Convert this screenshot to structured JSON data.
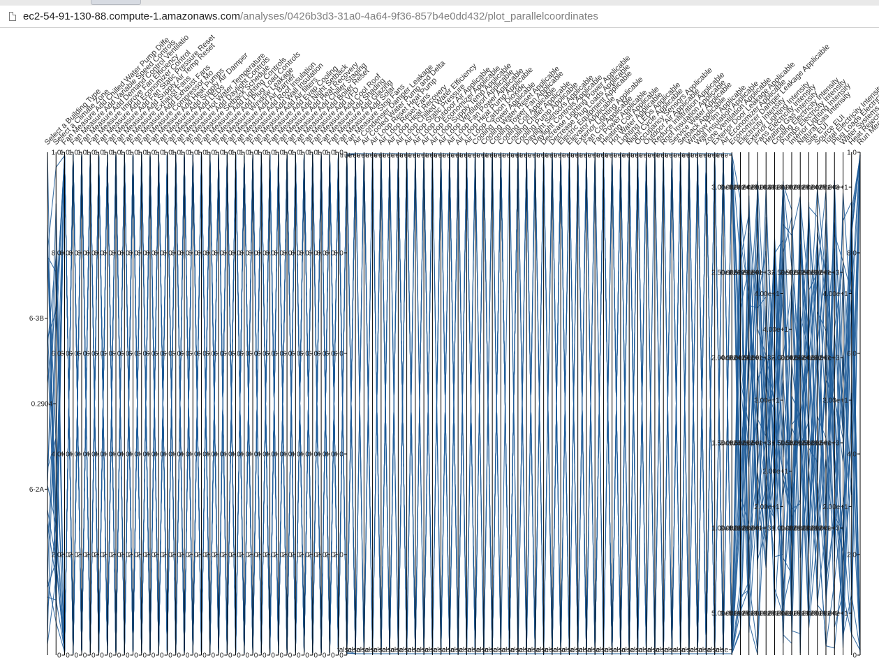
{
  "browser": {
    "url_host": "ec2-54-91-130-88.compute-1.amazonaws.com",
    "url_path": "/analyses/0426b3d3-31a0-4a64-9f36-857b4e0dd432/plot_parallelcoordinates"
  },
  "colors": {
    "line": "#1f5c99",
    "axis": "#000000"
  },
  "chart_data": {
    "type": "parallel-coordinates",
    "dimensions": [
      "Select a Building Type",
      "Select a Climate Zone",
      "Fan Measure Add Chilled Water Pump Diffe",
      "Fan Measure Add Variable Speed Controls",
      "Fan Measure Add Demand Control Ventilatio",
      "Fan Measure Improve Fan Efficiency",
      "Fan Measure Add Economizer Control",
      "Fan Measure Add Fan Static Pressure Reset",
      "Fan Measure Add Supply Air Temp Reset",
      "Fan Measure Exhaust Fans",
      "Fan Measure Add Exhaust Fans",
      "Fan Measure Compressor Mo",
      "Fan Measure Add Heat Pumps",
      "Fan Measure Add Supply Air Damper",
      "Fan Measure Add LEDs",
      "Fan Measure Hot Water Temperature",
      "Fan Measure Add Daylight Controls",
      "Fan Measure Setback Schedule",
      "Fan Measure Add Lighting Controls",
      "Fan Measure Add Plug Load Controls",
      "Fan Measure Window Leakage",
      "Fan Measure Add Air Barrier",
      "Fan Measure Add Roof Insulation",
      "Fan Measure Add Wall Insulation",
      "Fan Measure Add Air filters",
      "Fan Measure Add Evap Cooling",
      "Fan Measure Add Night Setback",
      "Fan Measure Add Heat Recovery",
      "Fan Measure Add Chiller Staging",
      "Fan Measure Add Boiler Reset",
      "Fan Measure Add VFD",
      "Fan Measure Add Cool Roof",
      "Fan Measure Add Shading",
      "Fan Measure Add Glazing",
      "Fan Measure Add Solar",
      "Fan Measure Stop Fans",
      "Air Condenser Damper Leakage",
      "Air Cooled Water Pump and Delta",
      "Air Loop Reset Heat Pump",
      "Air Loop Reset Fans",
      "Air Loop Heat Recovery",
      "Air Loop Chilled Water Efficiency",
      "Air Loop Static Pressure",
      "Air Loop Outdoor Air Applicable",
      "Air Loop Economizer Applicable",
      "Air Loop Supply Temp Applicable",
      "Air Loop Ventilation Applicable",
      "Air Loop Fan Power Applicable",
      "Air Loop Heat Pump Applicable",
      "Air Loop Carbon Dioxide",
      "Cooling Tower Applicable",
      "Cooling Water Reset Applicable",
      "Cooling Tower Fan Applicable",
      "Cooling Coil Applicable",
      "Cooling Chiller Applicable",
      "Cooling Pump Applicable",
      "Daylight Sensors Applicable",
      "Daylight Controls Applicable",
      "Decrease Lighting Power Applicable",
      "Decrease Plug Loads Applicable",
      "Electric Equipment Applicable",
      "Elevator Applicable",
      "Exterior Lighting Applicable",
      "Fan Coil Applicable",
      "Fan Power Applicable",
      "Heating Coil Applicable",
      "Hot Water Applicable",
      "Lighting LEDs Applicable",
      "Night Cycle Applicable",
      "Occupancy Sensors Applicable",
      "Outdoor Air Applicable",
      "Reduce Infiltration Applicable",
      "Roof Insulation Applicable",
      "Service Water Applicable",
      "Setback Applicable",
      "Window Film Applicable",
      "Wall Insulation Applicable",
      "Zone Ventilation Applicable",
      "Exterior Door Leakage Applicable",
      "Air Economizer Applicable",
      "Economizer Damper Leakage Applicable",
      "Electricity Intensity",
      "Exterior Lighting Intensity",
      "Fans Electricity Intensity",
      "Heating Gas Intensity",
      "Cooling Electricity Intensity",
      "Pumps Electricity Intensity",
      "Interior Lighting Intensity",
      "Natural Gas Intensity",
      "Site EUI",
      "Source EUI",
      "Total Electricity Intensity",
      "Plug Loads Electricity Intensity",
      "Water Systems Electricity Intensity",
      "Heat Rejection Intensity",
      "Run Measure"
    ],
    "axis_ticks": {
      "measure": [
        "0",
        "2.0",
        "4.0",
        "6.0",
        "8.0",
        "1.0"
      ],
      "boolean": [
        "false",
        "true"
      ],
      "building_type": [
        "6-2A",
        "6-3B"
      ],
      "climate_zone": [
        "0.2904"
      ],
      "electricity_intensity": [
        "5.00e+1",
        "1.00e+2",
        "1.50e+2",
        "2.00e+2",
        "2.50e+2",
        "3.00e+2"
      ],
      "gas_intensity": [
        "1.00e+2",
        "2.00e+2",
        "3.00e+2",
        "4.00e+2",
        "6.00e+2",
        "8.00e+2"
      ],
      "eui": [
        "5.00e+1",
        "1.00e+2",
        "1.50e+2",
        "2.00e+2",
        "2.50e+2",
        "3.00e+2"
      ],
      "source_eui": [
        "5.00e+2",
        "1.00e+3",
        "1.50e+3",
        "2.00e+3",
        "3.00e+3",
        "4.00e+3"
      ],
      "lighting_intensity": [
        "1.00e+1",
        "2.00e+1",
        "3.00e+1",
        "4.00e+1",
        "6.00e+1",
        "8.00e+1"
      ],
      "plug_intensity": [
        "1.00e+1",
        "2.00e+1",
        "3.00e+1",
        "4.00e+1",
        "5.00e+1"
      ],
      "water_intensity": [
        "1.00e+0",
        "2.00e+1",
        "4.00e+1",
        "6.00e+1"
      ],
      "rejection_intensity": [
        "5.00e+1",
        "1.00e+2",
        "1.50e+2",
        "2.00e+2",
        "2.50e+2",
        "3.00e+2"
      ]
    }
  }
}
